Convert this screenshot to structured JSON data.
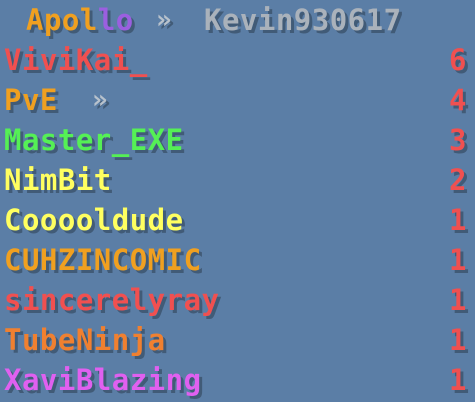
{
  "header": {
    "server": "Apollo",
    "separator": "»",
    "player": "Kevin930617",
    "server_color": "#f0a020",
    "server_accent_color": "#9b5fe0",
    "player_color": "#aab2bb"
  },
  "rows": [
    {
      "name": "ViviKai_",
      "suffix": "",
      "score": "6",
      "name_color": "#f05050"
    },
    {
      "name": "PvE",
      "suffix": "»",
      "score": "4",
      "name_color": "#f0a020"
    },
    {
      "name": "Master_EXE",
      "suffix": "",
      "score": "3",
      "name_color": "#55f055"
    },
    {
      "name": "NimBit",
      "suffix": "",
      "score": "2",
      "name_color": "#ffff60"
    },
    {
      "name": "Cooooldude",
      "suffix": "",
      "score": "1",
      "name_color": "#ffff60"
    },
    {
      "name": "CUHZINCOMIC",
      "suffix": "",
      "score": "1",
      "name_color": "#f0a020"
    },
    {
      "name": "sincerelyray",
      "suffix": "",
      "score": "1",
      "name_color": "#f05050"
    },
    {
      "name": "TubeNinja",
      "suffix": "",
      "score": "1",
      "name_color": "#f08030"
    },
    {
      "name": "XaviBlazing",
      "suffix": "",
      "score": "1",
      "name_color": "#e060f0"
    }
  ],
  "score_color": "#f05050"
}
